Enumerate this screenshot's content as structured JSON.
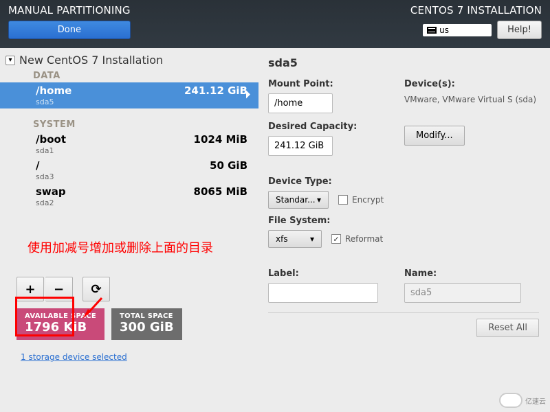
{
  "header": {
    "title_left": "MANUAL PARTITIONING",
    "title_right": "CENTOS 7 INSTALLATION",
    "done": "Done",
    "help": "Help!",
    "keyboard_layout": "us"
  },
  "left": {
    "install_title": "New CentOS 7 Installation",
    "sections": {
      "data": {
        "label": "DATA",
        "items": [
          {
            "mount": "/home",
            "size": "241.12 GiB",
            "device": "sda5",
            "selected": true
          }
        ]
      },
      "system": {
        "label": "SYSTEM",
        "items": [
          {
            "mount": "/boot",
            "size": "1024 MiB",
            "device": "sda1",
            "selected": false
          },
          {
            "mount": "/",
            "size": "50 GiB",
            "device": "sda3",
            "selected": false
          },
          {
            "mount": "swap",
            "size": "8065 MiB",
            "device": "sda2",
            "selected": false
          }
        ]
      }
    },
    "annotation": "使用加减号增加或删除上面的目录",
    "available_space": {
      "label": "AVAILABLE SPACE",
      "value": "1796 KiB"
    },
    "total_space": {
      "label": "TOTAL SPACE",
      "value": "300 GiB"
    },
    "storage_link": "1 storage device selected"
  },
  "right": {
    "device_heading": "sda5",
    "mount_point_label": "Mount Point:",
    "mount_point_value": "/home",
    "desired_capacity_label": "Desired Capacity:",
    "desired_capacity_value": "241.12 GiB",
    "devices_label": "Device(s):",
    "devices_text": "VMware, VMware Virtual S (sda)",
    "modify": "Modify...",
    "device_type_label": "Device Type:",
    "device_type_value": "Standar...",
    "encrypt_label": "Encrypt",
    "encrypt_checked": false,
    "file_system_label": "File System:",
    "file_system_value": "xfs",
    "reformat_label": "Reformat",
    "reformat_checked": true,
    "label_label": "Label:",
    "label_value": "",
    "name_label": "Name:",
    "name_value": "sda5",
    "reset_all": "Reset All"
  },
  "watermark": "亿速云"
}
